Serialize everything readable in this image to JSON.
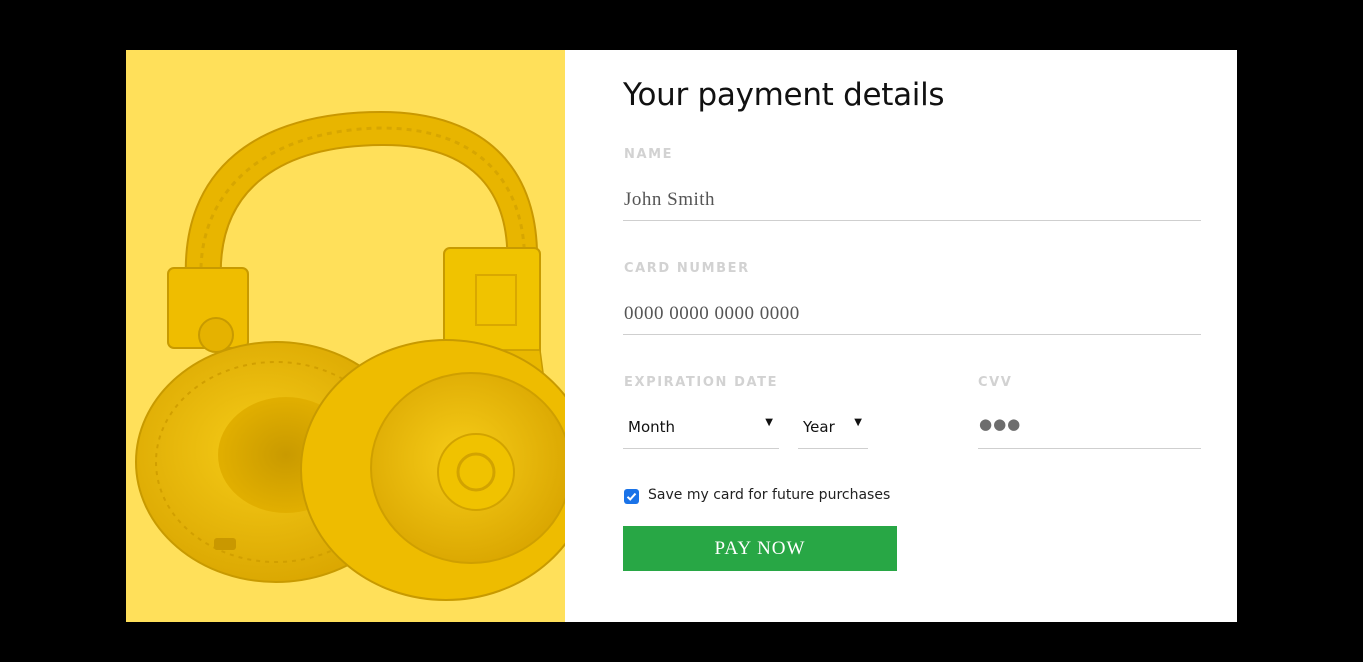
{
  "form": {
    "title": "Your payment details",
    "name": {
      "label": "NAME",
      "value": "John Smith"
    },
    "card_number": {
      "label": "CARD NUMBER",
      "placeholder": "0000 0000 0000 0000"
    },
    "expiration": {
      "label": "EXPIRATION DATE",
      "month": "Month",
      "year": "Year"
    },
    "cvv": {
      "label": "CVV",
      "value": "●●●"
    },
    "save_card": {
      "checked": true,
      "label": "Save my card for future purchases"
    },
    "pay_button": "PAY NOW"
  },
  "colors": {
    "image_background": "#ffe05a",
    "headphones": "#f2c200",
    "pay_button": "#28a745",
    "checkbox": "#1a73e8"
  },
  "image": {
    "subject": "yellow-headphones"
  }
}
